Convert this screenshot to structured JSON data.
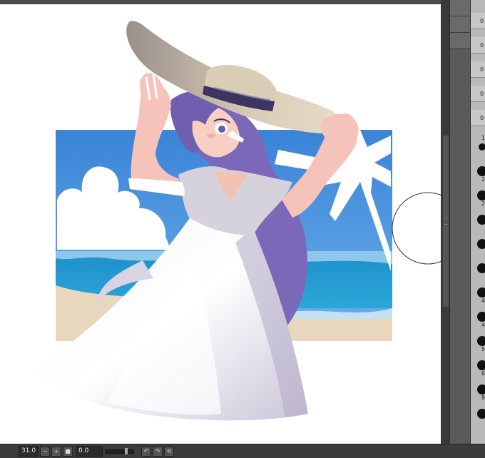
{
  "statusbar": {
    "zoom_value": "31.0",
    "rotation_value": "0.0"
  },
  "brush_panel": {
    "labels": [
      "0",
      "0",
      "0",
      "0",
      "0",
      "1",
      "2",
      "2",
      "4",
      "4",
      "5",
      "6",
      "8"
    ]
  },
  "icons": {
    "zoom_out": "minus-icon",
    "zoom_in": "plus-icon",
    "fit": "square-icon",
    "rotate_left": "rotate-left-icon",
    "rotate_right": "rotate-right-icon",
    "reset": "reset-icon",
    "brush_cursor": "circle-cursor-icon"
  }
}
